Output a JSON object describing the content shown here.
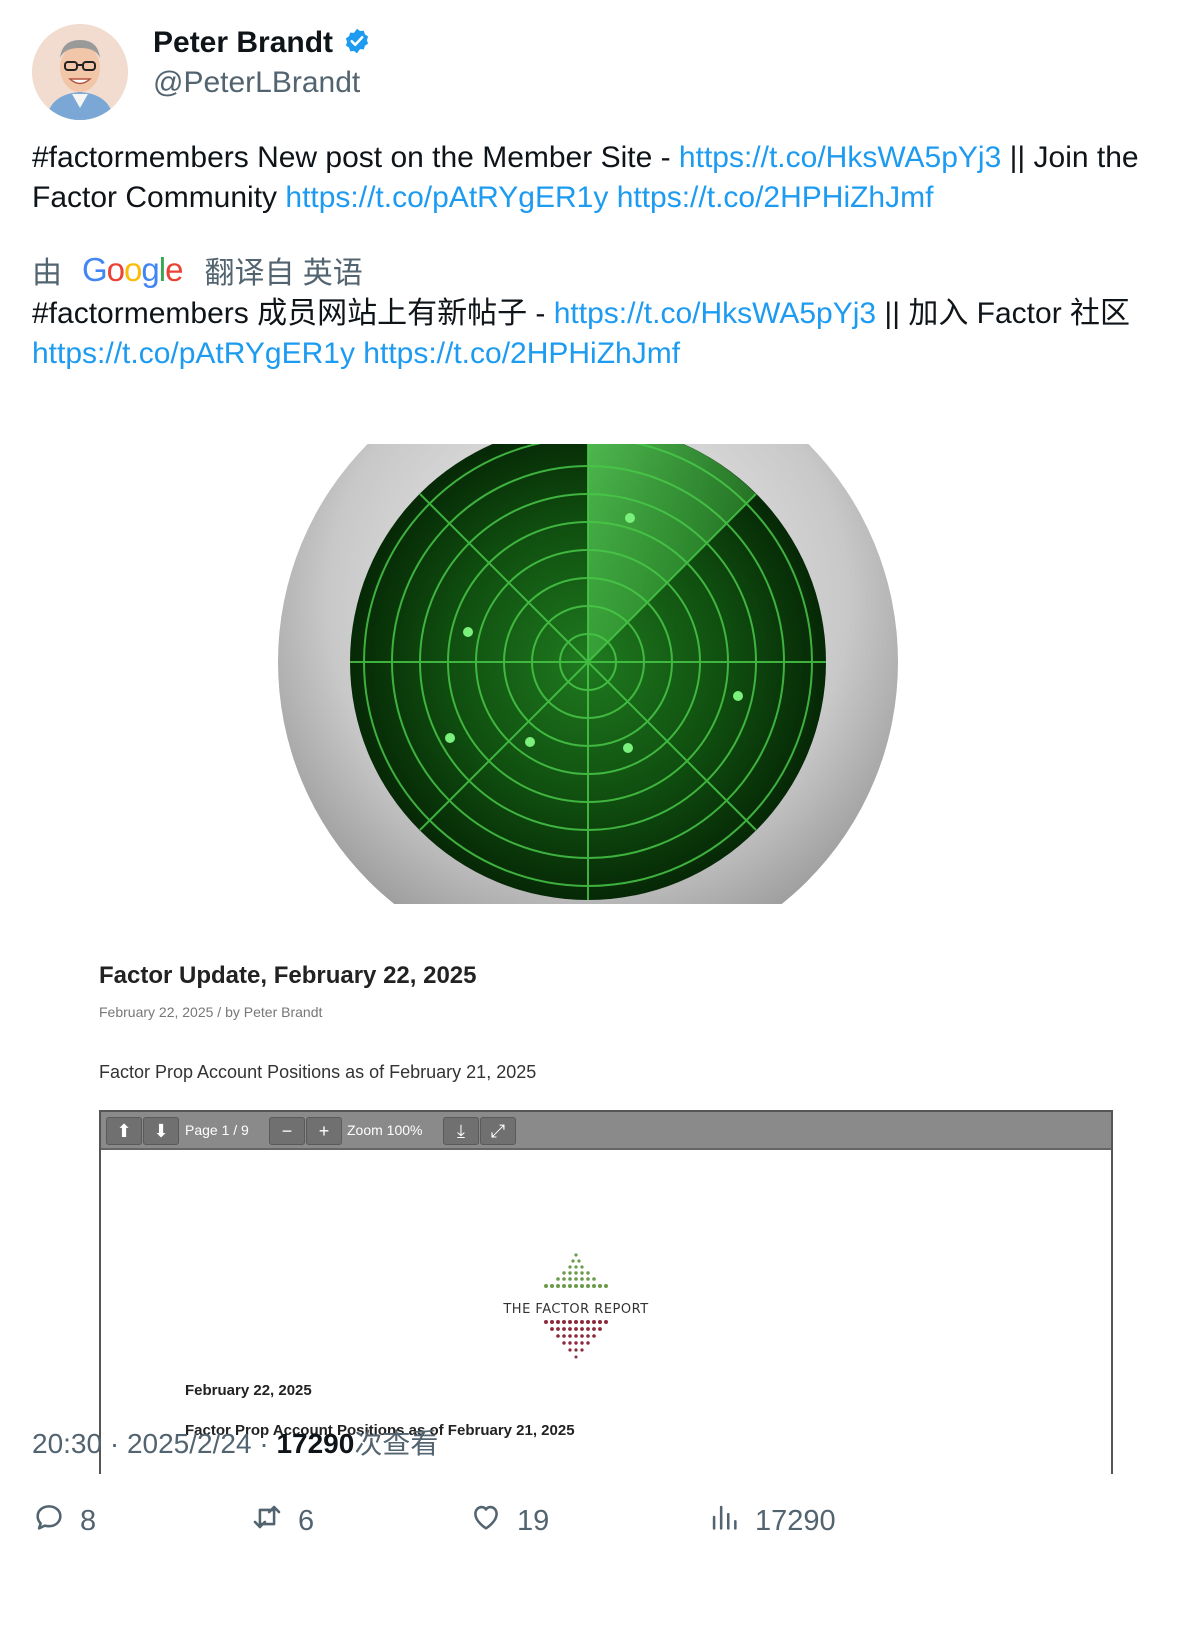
{
  "author": {
    "display_name": "Peter Brandt",
    "handle": "@PeterLBrandt",
    "verified": true
  },
  "tweet": {
    "text_part1": "#factormembers New post on the Member Site - ",
    "link1": "https://t.co/HksWA5pYj3",
    "text_part2": " || Join the Factor Community ",
    "link2": "https://t.co/pAtRYgER1y",
    "link3": "https://t.co/2HPHiZhJmf"
  },
  "translation": {
    "prefix": "由",
    "provider": "Google",
    "suffix": "翻译自 英语",
    "text_part1": "#factormembers 成员网站上有新帖子 - ",
    "link1": "https://t.co/HksWA5pYj3",
    "text_part2": " || 加入 Factor 社区 ",
    "link2": "https://t.co/pAtRYgER1y",
    "link3": "https://t.co/2HPHiZhJmf"
  },
  "media": {
    "post_title": "Factor Update, February 22, 2025",
    "post_date": "February 22, 2025",
    "post_by": "/ by",
    "post_author": "Peter Brandt",
    "post_subtitle": "Factor Prop Account Positions as of February 21, 2025",
    "pdf_toolbar": {
      "page": "Page 1 / 9",
      "zoom": "Zoom 100%"
    },
    "pdf_logo_text": "THE FACTOR REPORT",
    "pdf_date": "February 22, 2025",
    "pdf_heading": "Factor Prop Account Positions as of February 21, 2025"
  },
  "meta": {
    "time": "20:30",
    "date": "2025/2/24",
    "views": "17290",
    "views_label": "次查看"
  },
  "actions": {
    "replies": "8",
    "retweets": "6",
    "likes": "19",
    "views": "17290"
  },
  "colors": {
    "link": "#1d9bf0",
    "secondary_text": "#536471",
    "verified_badge": "#1d9bf0",
    "radar_green": "#3fbf3f"
  }
}
